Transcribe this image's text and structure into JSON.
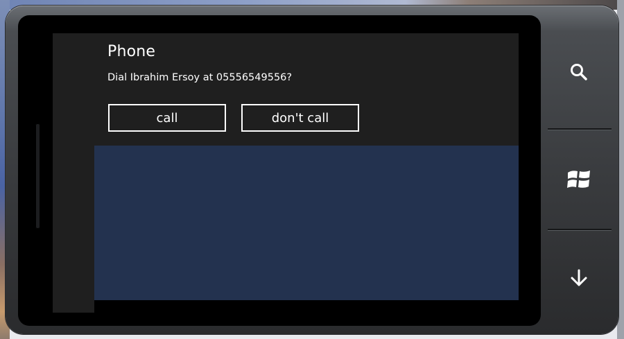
{
  "dialog": {
    "title": "Phone",
    "message": "Dial Ibrahim Ersoy at 05556549556?",
    "buttons": {
      "call_label": "call",
      "dont_call_label": "don't call"
    }
  },
  "hardware_buttons": [
    {
      "icon": "search-icon"
    },
    {
      "icon": "windows-start-icon"
    },
    {
      "icon": "back-arrow-icon"
    }
  ],
  "colors": {
    "dialog_background": "#1f1f1f",
    "app_background": "#23324f",
    "text": "#ffffff",
    "emulator_shell": "#3a3c3f"
  }
}
